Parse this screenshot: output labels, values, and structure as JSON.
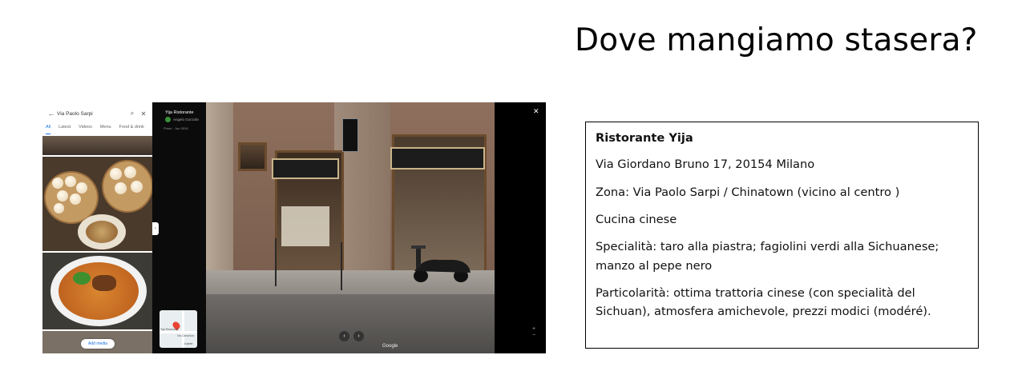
{
  "slide": {
    "title": "Dove mangiamo stasera?"
  },
  "screenshot": {
    "search_query": "Via Paolo Sarpi",
    "tabs": [
      "All",
      "Latest",
      "Videos",
      "Menu",
      "Food & drink"
    ],
    "add_media_label": "Add media",
    "place_name": "Yija Ristorante",
    "author": "Angelo Gorzolin",
    "photo_date": "Photo · Jun 2019",
    "map_label_1": "Yija Ristorante",
    "map_label_2": "Via Canonica",
    "map_label_3": "Jurjeetr",
    "watermark": "Google",
    "icons": [
      "back-arrow-icon",
      "search-icon",
      "close-icon",
      "more-icon",
      "prev-arrow-icon",
      "next-arrow-icon",
      "zoom-in-icon",
      "zoom-out-icon"
    ]
  },
  "info": {
    "name": "Ristorante Yija",
    "address": "Via Giordano Bruno 17, 20154 Milano",
    "zone": "Zona: Via Paolo Sarpi / Chinatown (vicino al centro )",
    "cuisine": "Cucina cinese",
    "specialties": "Specialità: taro alla piastra; fagiolini verdi alla Sichuanese; manzo al pepe nero",
    "features": "Particolarità: ottima trattoria cinese (con specialità del Sichuan), atmosfera amichevole, prezzi modici (modéré)."
  },
  "colors": {
    "accent": "#1a73e8",
    "pin": "#ea4335",
    "border": "#000000"
  }
}
